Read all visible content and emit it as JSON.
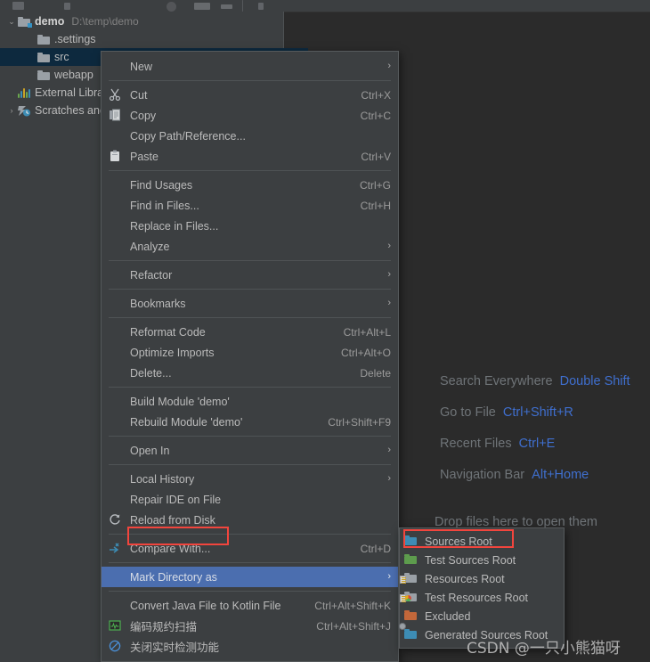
{
  "window": {
    "background_color": "#2b2b2b",
    "panel_color": "#3c3f41",
    "accent_color": "#4b6eaf",
    "annotation_color": "#f2453d"
  },
  "project_tree": {
    "items": [
      {
        "label": "demo",
        "path": "D:\\temp\\demo",
        "icon": "module-folder-icon",
        "indent": 0,
        "arrow": "⌄",
        "selected": false,
        "bold": true
      },
      {
        "label": ".settings",
        "path": "",
        "icon": "folder-icon",
        "indent": 1,
        "arrow": "",
        "selected": false,
        "bold": false
      },
      {
        "label": "src",
        "path": "",
        "icon": "folder-icon",
        "indent": 1,
        "arrow": "",
        "selected": true,
        "bold": false
      },
      {
        "label": "webapp",
        "path": "",
        "icon": "folder-icon",
        "indent": 1,
        "arrow": "",
        "selected": false,
        "bold": false
      },
      {
        "label": "External Libraries",
        "path": "",
        "icon": "library-icon",
        "indent": 0,
        "arrow": "",
        "selected": false,
        "bold": false
      },
      {
        "label": "Scratches and Consoles",
        "path": "",
        "icon": "scratches-icon",
        "indent": 0,
        "arrow": "›",
        "selected": false,
        "bold": false
      }
    ]
  },
  "context_menu": {
    "items": [
      {
        "kind": "item",
        "label": "New",
        "mnemonic": "",
        "shortcut": "",
        "arrow": "›",
        "icon": "",
        "highlight": false
      },
      {
        "kind": "separator"
      },
      {
        "kind": "item",
        "label": "Cut",
        "mnemonic": "t",
        "shortcut": "Ctrl+X",
        "arrow": "",
        "icon": "cut-icon",
        "highlight": false
      },
      {
        "kind": "item",
        "label": "Copy",
        "mnemonic": "C",
        "shortcut": "Ctrl+C",
        "arrow": "",
        "icon": "copy-icon",
        "highlight": false
      },
      {
        "kind": "item",
        "label": "Copy Path/Reference...",
        "mnemonic": "",
        "shortcut": "",
        "arrow": "",
        "icon": "",
        "highlight": false
      },
      {
        "kind": "item",
        "label": "Paste",
        "mnemonic": "P",
        "shortcut": "Ctrl+V",
        "arrow": "",
        "icon": "paste-icon",
        "highlight": false
      },
      {
        "kind": "separator"
      },
      {
        "kind": "item",
        "label": "Find Usages",
        "mnemonic": "U",
        "shortcut": "Ctrl+G",
        "arrow": "",
        "icon": "",
        "highlight": false
      },
      {
        "kind": "item",
        "label": "Find in Files...",
        "mnemonic": "",
        "shortcut": "Ctrl+H",
        "arrow": "",
        "icon": "",
        "highlight": false
      },
      {
        "kind": "item",
        "label": "Replace in Files...",
        "mnemonic": "c",
        "shortcut": "",
        "arrow": "",
        "icon": "",
        "highlight": false
      },
      {
        "kind": "item",
        "label": "Analyze",
        "mnemonic": "z",
        "shortcut": "",
        "arrow": "›",
        "icon": "",
        "highlight": false
      },
      {
        "kind": "separator"
      },
      {
        "kind": "item",
        "label": "Refactor",
        "mnemonic": "R",
        "shortcut": "",
        "arrow": "›",
        "icon": "",
        "highlight": false
      },
      {
        "kind": "separator"
      },
      {
        "kind": "item",
        "label": "Bookmarks",
        "mnemonic": "",
        "shortcut": "",
        "arrow": "›",
        "icon": "",
        "highlight": false
      },
      {
        "kind": "separator"
      },
      {
        "kind": "item",
        "label": "Reformat Code",
        "mnemonic": "R",
        "shortcut": "Ctrl+Alt+L",
        "arrow": "",
        "icon": "",
        "highlight": false
      },
      {
        "kind": "item",
        "label": "Optimize Imports",
        "mnemonic": "z",
        "shortcut": "Ctrl+Alt+O",
        "arrow": "",
        "icon": "",
        "highlight": false
      },
      {
        "kind": "item",
        "label": "Delete...",
        "mnemonic": "D",
        "shortcut": "Delete",
        "arrow": "",
        "icon": "",
        "highlight": false
      },
      {
        "kind": "separator"
      },
      {
        "kind": "item",
        "label": "Build Module 'demo'",
        "mnemonic": "M",
        "shortcut": "",
        "arrow": "",
        "icon": "",
        "highlight": false
      },
      {
        "kind": "item",
        "label": "Rebuild Module 'demo'",
        "mnemonic": "e",
        "shortcut": "Ctrl+Shift+F9",
        "arrow": "",
        "icon": "",
        "highlight": false
      },
      {
        "kind": "separator"
      },
      {
        "kind": "item",
        "label": "Open In",
        "mnemonic": "",
        "shortcut": "",
        "arrow": "›",
        "icon": "",
        "highlight": false
      },
      {
        "kind": "separator"
      },
      {
        "kind": "item",
        "label": "Local History",
        "mnemonic": "H",
        "shortcut": "",
        "arrow": "›",
        "icon": "",
        "highlight": false
      },
      {
        "kind": "item",
        "label": "Repair IDE on File",
        "mnemonic": "",
        "shortcut": "",
        "arrow": "",
        "icon": "",
        "highlight": false
      },
      {
        "kind": "item",
        "label": "Reload from Disk",
        "mnemonic": "",
        "shortcut": "",
        "arrow": "",
        "icon": "reload-icon",
        "highlight": false
      },
      {
        "kind": "separator"
      },
      {
        "kind": "item",
        "label": "Compare With...",
        "mnemonic": "",
        "shortcut": "Ctrl+D",
        "arrow": "",
        "icon": "compare-icon",
        "highlight": false
      },
      {
        "kind": "separator"
      },
      {
        "kind": "item",
        "label": "Mark Directory as",
        "mnemonic": "",
        "shortcut": "",
        "arrow": "›",
        "icon": "",
        "highlight": true
      },
      {
        "kind": "separator"
      },
      {
        "kind": "item",
        "label": "Convert Java File to Kotlin File",
        "mnemonic": "",
        "shortcut": "Ctrl+Alt+Shift+K",
        "arrow": "",
        "icon": "",
        "highlight": false
      },
      {
        "kind": "item",
        "label": "编码规约扫描",
        "mnemonic": "",
        "shortcut": "Ctrl+Alt+Shift+J",
        "arrow": "",
        "icon": "scan-icon",
        "highlight": false
      },
      {
        "kind": "item",
        "label": "关闭实时检测功能",
        "mnemonic": "",
        "shortcut": "",
        "arrow": "",
        "icon": "disable-icon",
        "highlight": false
      }
    ]
  },
  "sub_menu": {
    "title": "Mark Directory as",
    "items": [
      {
        "label": "Sources Root",
        "icon": "sources-root-icon",
        "color": "#3d8cb4",
        "highlight": false
      },
      {
        "label": "Test Sources Root",
        "icon": "test-sources-root-icon",
        "color": "#5d9c4d",
        "highlight": false
      },
      {
        "label": "Resources Root",
        "icon": "resources-root-icon",
        "color": "#9aa0a6",
        "highlight": false
      },
      {
        "label": "Test Resources Root",
        "icon": "test-resources-root-icon",
        "color": "#9aa0a6",
        "highlight": false
      },
      {
        "label": "Excluded",
        "icon": "excluded-icon",
        "color": "#c2673a",
        "highlight": false
      },
      {
        "label": "Generated Sources Root",
        "icon": "generated-sources-root-icon",
        "color": "#3d8cb4",
        "highlight": false
      }
    ]
  },
  "editor_hints": {
    "rows": [
      {
        "label": "Search Everywhere",
        "key": "Double Shift"
      },
      {
        "label": "Go to File",
        "key": "Ctrl+Shift+R"
      },
      {
        "label": "Recent Files",
        "key": "Ctrl+E"
      },
      {
        "label": "Navigation Bar",
        "key": "Alt+Home"
      }
    ],
    "drop_hint": "Drop files here to open them"
  },
  "watermark": {
    "text": "CSDN @一只小熊猫呀"
  }
}
